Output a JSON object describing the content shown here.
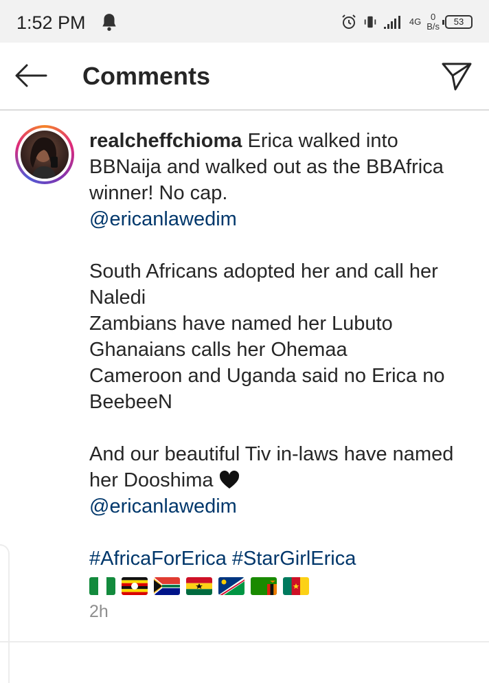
{
  "status_bar": {
    "time": "1:52 PM",
    "network_type": "4G",
    "speed_value": "0",
    "speed_unit": "B/s",
    "battery": "53"
  },
  "header": {
    "title": "Comments"
  },
  "comment": {
    "username": "realcheffchioma",
    "line1_text": " Erica walked into BBNaija and walked out as the BBAfrica winner! No cap.",
    "mention1": "@ericanlawedim",
    "line_south_africa": "South Africans adopted her and call her Naledi",
    "line_zambia": "Zambians have named her Lubuto",
    "line_ghana": "Ghanaians calls her Ohemaa",
    "line_cameroon": "Cameroon and Uganda said no Erica no BeebeeN",
    "line_tiv": "And our beautiful Tiv in-laws have named her Dooshima",
    "mention2": "@ericanlawedim",
    "hashtags": "#AfricaForErica #StarGirlErica",
    "flags": [
      "nigeria-flag",
      "uganda-flag",
      "south-africa-flag",
      "ghana-flag",
      "namibia-flag",
      "zambia-flag",
      "cameroon-flag"
    ],
    "timestamp": "2h"
  },
  "colors": {
    "mention": "#00376b",
    "text": "#262626",
    "muted": "#8e8e8e"
  }
}
